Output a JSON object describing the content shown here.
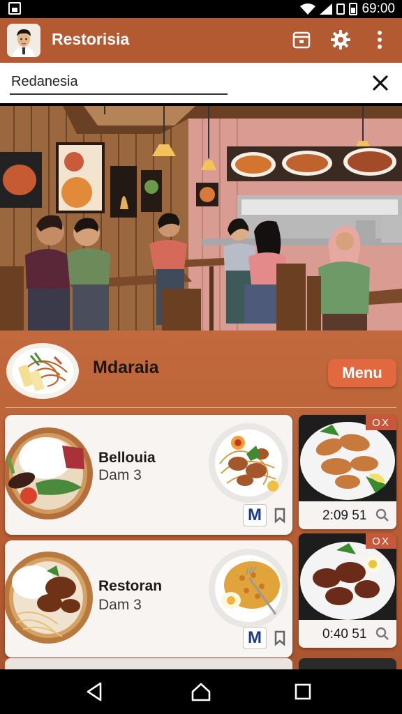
{
  "status_bar": {
    "time": "69:00",
    "icons": [
      "gallery-icon",
      "wifi-icon",
      "signal-icon",
      "sim-icon",
      "battery-icon"
    ]
  },
  "app_bar": {
    "title": "Restorisia",
    "icons": [
      "archive-icon",
      "gear-icon",
      "more-vert-icon"
    ]
  },
  "search": {
    "value": "Redanesia"
  },
  "featured": {
    "name": "Mdaraia",
    "menu_label": "Menu"
  },
  "cards": [
    {
      "title": "Bellouia",
      "subtitle": "Dam 3",
      "badge": "M"
    },
    {
      "title": "Restoran",
      "subtitle": "Dam 3",
      "badge": "M"
    }
  ],
  "side_cards": [
    {
      "close_label": "OX",
      "time": "2:09 51"
    },
    {
      "close_label": "OX",
      "time": "0:40 51"
    }
  ],
  "colors": {
    "primary": "#b35a32",
    "accent": "#e2683f",
    "card_bg": "#f7f4f1",
    "badge_text": "#1c3a8a"
  },
  "nav_bar": {
    "icons": [
      "back-icon",
      "home-icon",
      "recents-icon"
    ]
  }
}
